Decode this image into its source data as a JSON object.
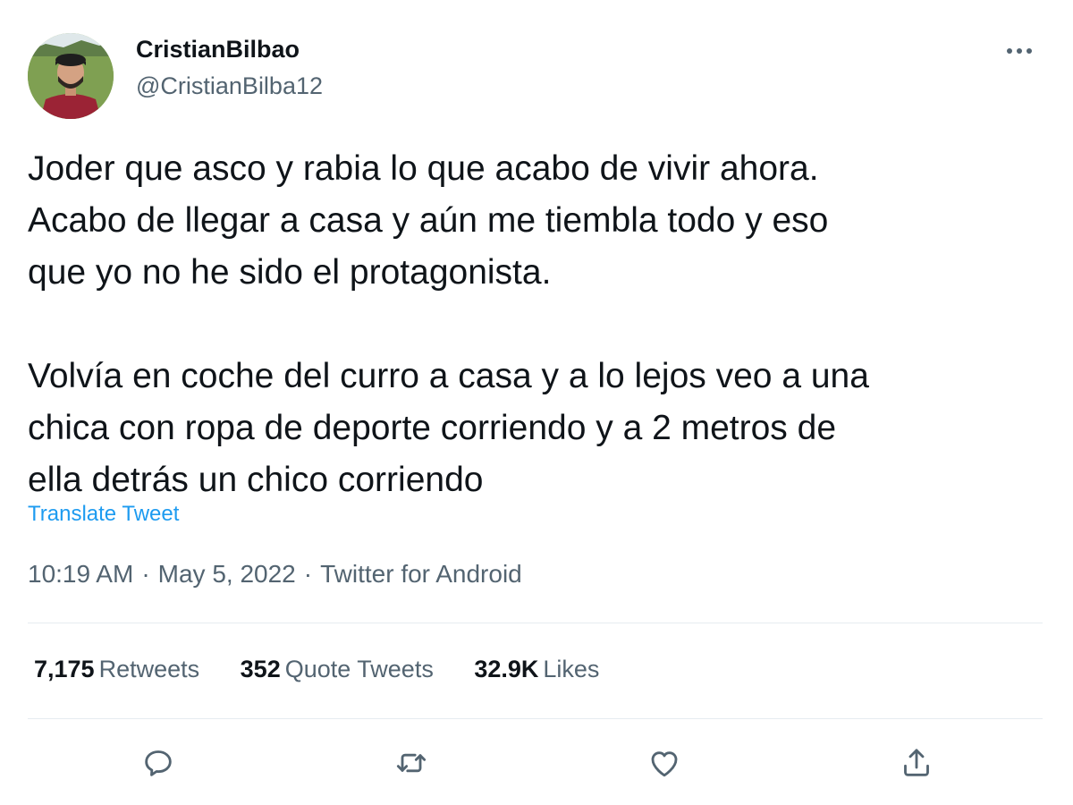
{
  "author": {
    "display_name": "CristianBilbao",
    "handle": "@CristianBilba12",
    "avatar_icon": "profile-photo"
  },
  "menu": {
    "more_icon": "more-horizontal-icon"
  },
  "tweet": {
    "paragraphs": [
      "Joder que asco y rabia lo que acabo de vivir ahora.\nAcabo de llegar a casa y aún me tiembla todo y eso\nque yo no he sido el protagonista.",
      "Volvía en coche del curro a casa y a lo lejos veo a una\nchica con ropa de deporte corriendo y a 2 metros de\nella detrás un chico corriendo"
    ],
    "translate_label": "Translate Tweet",
    "time": "10:19 AM",
    "date": "May 5, 2022",
    "source": "Twitter for Android",
    "separator": "·"
  },
  "stats": {
    "retweets_count": "7,175",
    "retweets_label": "Retweets",
    "quotes_count": "352",
    "quotes_label": "Quote Tweets",
    "likes_count": "32.9K",
    "likes_label": "Likes"
  },
  "actions": {
    "reply_icon": "reply-icon",
    "retweet_icon": "retweet-icon",
    "like_icon": "heart-icon",
    "share_icon": "share-icon"
  },
  "colors": {
    "text_primary": "#0f1419",
    "text_secondary": "#536471",
    "link": "#1d9bf0",
    "divider": "#e6ecf0"
  }
}
